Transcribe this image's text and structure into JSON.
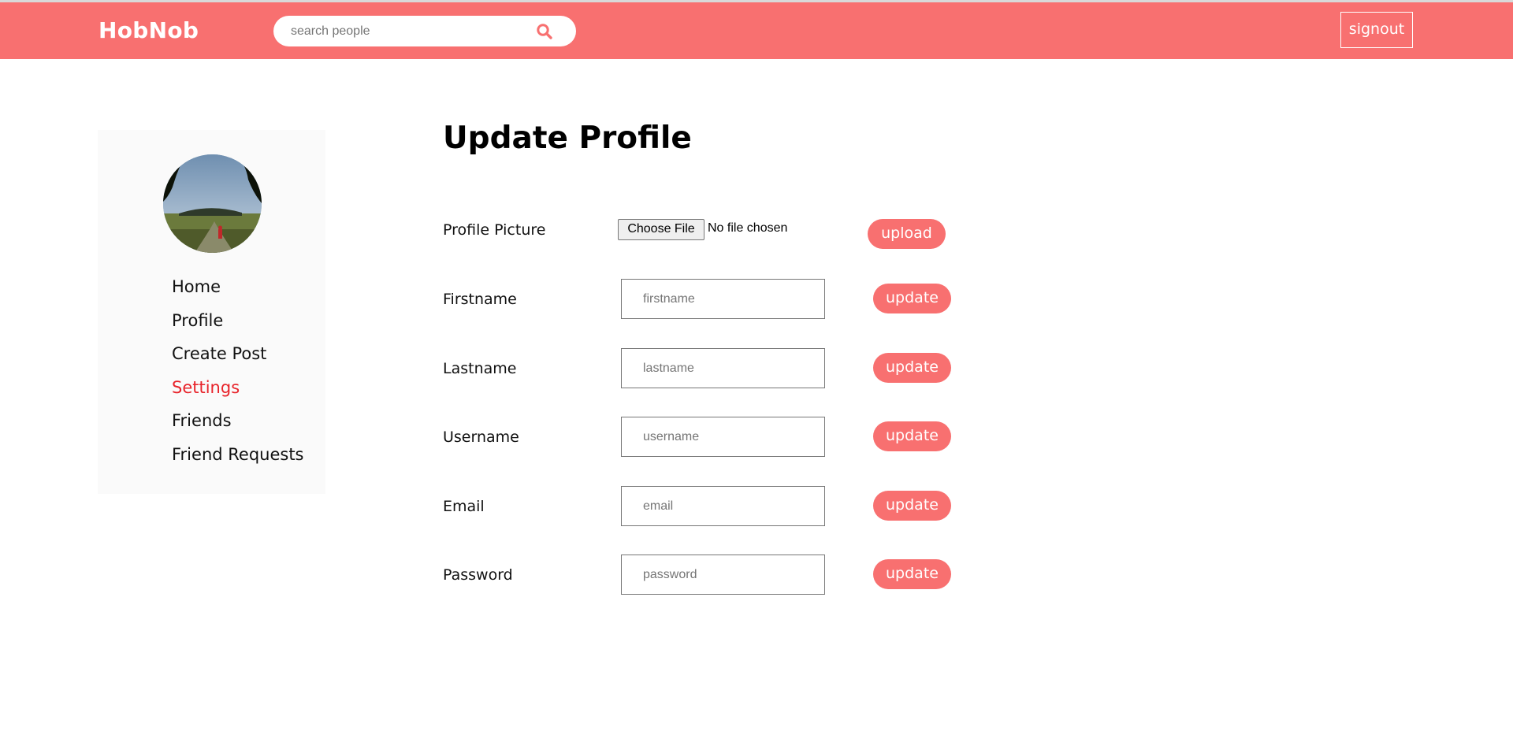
{
  "header": {
    "brand": "HobNob",
    "search_placeholder": "search people",
    "signout_label": "signout",
    "accent_color": "#f87070"
  },
  "sidebar": {
    "items": [
      {
        "label": "Home"
      },
      {
        "label": "Profile"
      },
      {
        "label": "Create Post"
      },
      {
        "label": "Settings",
        "active": true
      },
      {
        "label": "Friends"
      },
      {
        "label": "Friend Requests"
      }
    ],
    "active_color": "#e8232a"
  },
  "main": {
    "title": "Update Profile",
    "picture": {
      "label": "Profile Picture",
      "choose_label": "Choose File",
      "status": "No file chosen",
      "upload_label": "upload"
    },
    "fields": [
      {
        "label": "Firstname",
        "placeholder": "firstname",
        "button": "update"
      },
      {
        "label": "Lastname",
        "placeholder": "lastname",
        "button": "update"
      },
      {
        "label": "Username",
        "placeholder": "username",
        "button": "update"
      },
      {
        "label": "Email",
        "placeholder": "email",
        "button": "update"
      },
      {
        "label": "Password",
        "placeholder": "password",
        "button": "update"
      }
    ]
  }
}
